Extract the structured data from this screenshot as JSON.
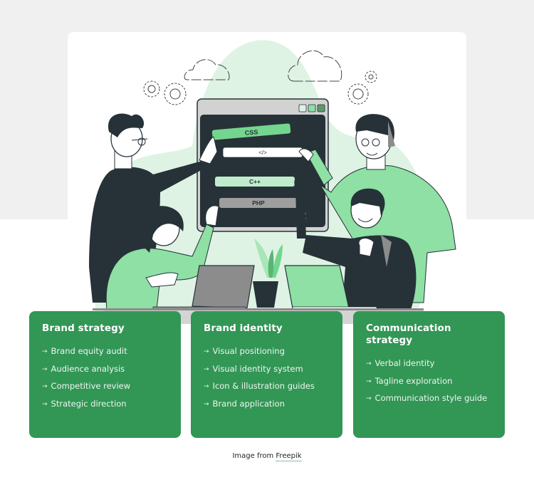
{
  "illustration": {
    "code_labels": [
      "CSS",
      "</>",
      "C++",
      "PHP"
    ],
    "colors": {
      "green_light": "#dff3e4",
      "green_mid": "#8ee0a4",
      "green_accent": "#74d68e",
      "dark": "#263238",
      "gray": "#8c8c8c",
      "card_green": "#329655",
      "band_gray": "#f0f0f0"
    }
  },
  "cards": [
    {
      "title": "Brand strategy",
      "items": [
        "Brand equity audit",
        "Audience analysis",
        "Competitive review",
        "Strategic direction"
      ]
    },
    {
      "title": "Brand identity",
      "items": [
        "Visual positioning",
        "Visual identity system",
        "Icon & illustration guides",
        "Brand application"
      ]
    },
    {
      "title": "Communication strategy",
      "items": [
        "Verbal identity",
        "Tagline exploration",
        "Communication style guide"
      ]
    }
  ],
  "arrow_glyph": "→",
  "credit": {
    "prefix": "Image from ",
    "link_label": "Freepik"
  }
}
